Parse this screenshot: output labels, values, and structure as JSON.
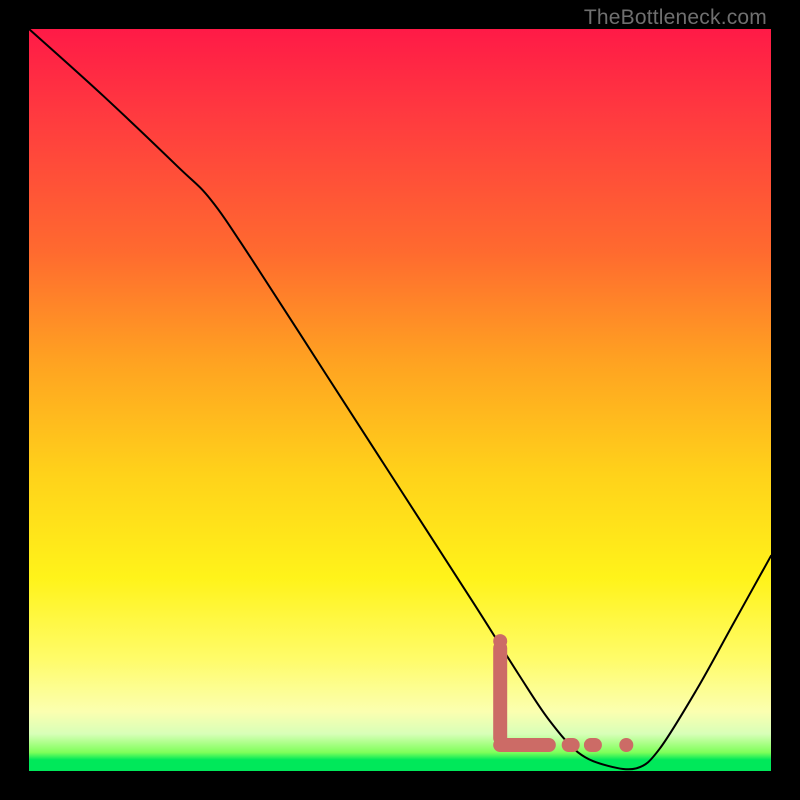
{
  "watermark_text": "TheBottleneck.com",
  "chart_data": {
    "type": "line",
    "title": "",
    "xlabel": "",
    "ylabel": "",
    "x_range_pct": [
      0,
      100
    ],
    "y_range_pct": [
      0,
      100
    ],
    "series": [
      {
        "name": "bottleneck-curve",
        "note": "Y is percent from top (0 = top of plot, 100 = bottom). X is percent from left.",
        "points": [
          {
            "x": 0.0,
            "y": 0.0
          },
          {
            "x": 10.0,
            "y": 9.0
          },
          {
            "x": 20.0,
            "y": 18.5
          },
          {
            "x": 24.5,
            "y": 23.0
          },
          {
            "x": 30.0,
            "y": 31.0
          },
          {
            "x": 40.0,
            "y": 46.5
          },
          {
            "x": 50.0,
            "y": 62.0
          },
          {
            "x": 60.0,
            "y": 77.5
          },
          {
            "x": 66.0,
            "y": 87.0
          },
          {
            "x": 70.0,
            "y": 93.0
          },
          {
            "x": 74.0,
            "y": 97.5
          },
          {
            "x": 78.0,
            "y": 99.3
          },
          {
            "x": 82.0,
            "y": 99.6
          },
          {
            "x": 85.0,
            "y": 97.0
          },
          {
            "x": 90.0,
            "y": 89.0
          },
          {
            "x": 95.0,
            "y": 80.0
          },
          {
            "x": 100.0,
            "y": 71.0
          }
        ]
      }
    ],
    "markers": {
      "name": "highlighted-range",
      "color": "#cc6b66",
      "thick_L_vertical_head_x": 63.5,
      "thick_L_vertical_top_y": 82.5,
      "thick_L_vertical_bottom_y": 96.5,
      "thick_L_horizontal_end_x": 71.0,
      "dash_segments_x": [
        73.0,
        76.0
      ],
      "dot_x": 80.5,
      "baseline_y": 96.5
    }
  }
}
